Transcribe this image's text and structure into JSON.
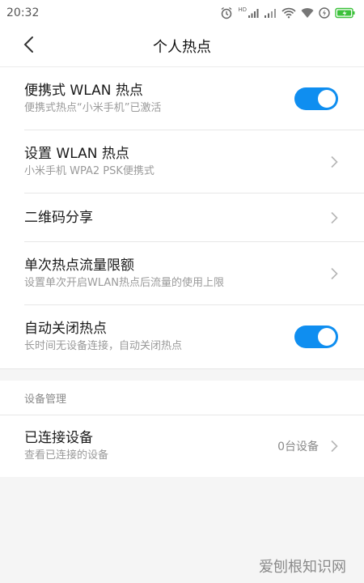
{
  "status_bar": {
    "time": "20:32",
    "network_label": "HD"
  },
  "header": {
    "title": "个人热点"
  },
  "settings": [
    {
      "title": "便携式 WLAN 热点",
      "subtitle": "便携式热点“小米手机”已激活",
      "control": "toggle",
      "enabled": true
    },
    {
      "title": "设置 WLAN 热点",
      "subtitle": "小米手机 WPA2 PSK便携式",
      "control": "chevron"
    },
    {
      "title": "二维码分享",
      "subtitle": "",
      "control": "chevron"
    },
    {
      "title": "单次热点流量限额",
      "subtitle": "设置单次开启WLAN热点后流量的使用上限",
      "control": "chevron"
    },
    {
      "title": "自动关闭热点",
      "subtitle": "长时间无设备连接，自动关闭热点",
      "control": "toggle",
      "enabled": true
    }
  ],
  "device_section": {
    "header": "设备管理",
    "item": {
      "title": "已连接设备",
      "subtitle": "查看已连接的设备",
      "value": "0台设备"
    }
  },
  "watermark": "爱刨根知识网",
  "colors": {
    "accent": "#0f8ef0",
    "background": "#f5f5f5",
    "battery": "#3cc13b"
  }
}
